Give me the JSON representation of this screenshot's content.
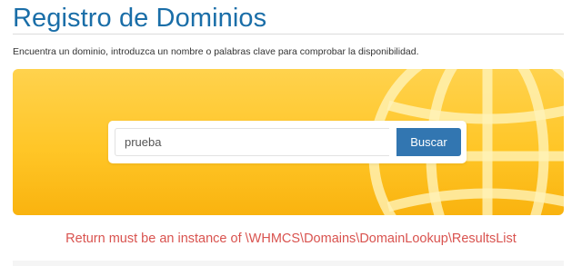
{
  "header": {
    "title": "Registro de Dominios",
    "subtitle": "Encuentra un dominio, introduzca un nombre o palabras clave para comprobar la disponibilidad."
  },
  "search": {
    "value": "prueba",
    "button_label": "Buscar",
    "button_color": "#3276b1"
  },
  "banner": {
    "background_color": "#ffc627",
    "icon": "globe-icon"
  },
  "error": {
    "message": "Return must be an instance of \\WHMCS\\Domains\\DomainLookup\\ResultsList",
    "color": "#d9534f"
  },
  "colors": {
    "title": "#1a6ea8"
  }
}
